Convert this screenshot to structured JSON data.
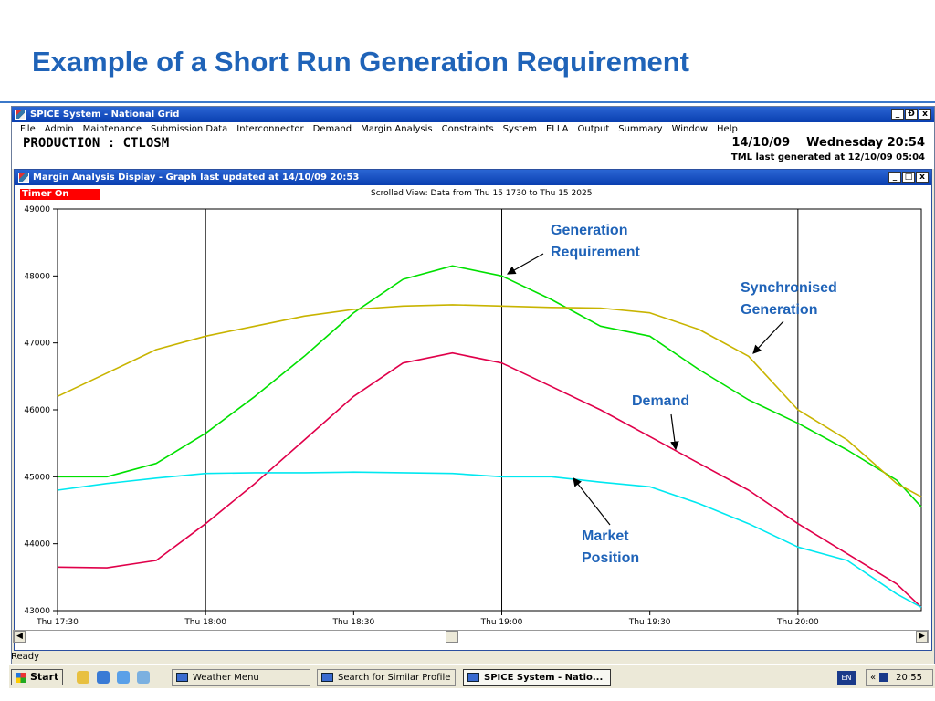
{
  "slide": {
    "title": "Example of a Short Run Generation Requirement"
  },
  "app": {
    "title": "SPICE System - National Grid",
    "window_buttons": [
      "_",
      "Ɖ",
      "x"
    ],
    "menu": [
      "File",
      "Admin",
      "Maintenance",
      "Submission Data",
      "Interconnector",
      "Demand",
      "Margin Analysis",
      "Constraints",
      "System",
      "ELLA",
      "Output",
      "Summary",
      "Window",
      "Help"
    ],
    "production": "PRODUCTION : CTLOSM",
    "date": "14/10/09",
    "day_time": "Wednesday 20:54",
    "tml": "TML last generated at 12/10/09 05:04"
  },
  "child": {
    "title": "Margin Analysis Display - Graph last updated at 14/10/09 20:53",
    "timer": "Timer On",
    "scrolled_view": "Scrolled View: Data from Thu 15 1730  to Thu 15 2025"
  },
  "annotations": {
    "generation_requirement": [
      "Generation",
      "Requirement"
    ],
    "synchronised_generation": [
      "Synchronised",
      "Generation"
    ],
    "demand": "Demand",
    "market_position": [
      "Market",
      "Position"
    ]
  },
  "chart_data": {
    "type": "line",
    "x": [
      "17:30",
      "17:40",
      "17:50",
      "18:00",
      "18:10",
      "18:20",
      "18:30",
      "18:40",
      "18:50",
      "19:00",
      "19:10",
      "19:20",
      "19:30",
      "19:40",
      "19:50",
      "20:00",
      "20:10",
      "20:20",
      "20:25"
    ],
    "x_tick_labels": [
      "Thu 17:30",
      "Thu 18:00",
      "Thu 18:30",
      "Thu 19:00",
      "Thu 19:30",
      "Thu 20:00"
    ],
    "y_tick_labels": [
      "49000",
      "48000",
      "47000",
      "46000",
      "45000",
      "44000",
      "43000"
    ],
    "ylim": [
      43000,
      49000
    ],
    "vertical_markers": [
      "18:00",
      "19:00",
      "20:00"
    ],
    "grid": false,
    "series": [
      {
        "color": "#00e000",
        "values": [
          45000,
          45000,
          45200,
          45650,
          46200,
          46800,
          47450,
          47950,
          48150,
          48000,
          47650,
          47250,
          47100,
          46600,
          46150,
          45800,
          45400,
          44950,
          44550
        ]
      },
      {
        "color": "#c8b400",
        "values": [
          46200,
          46550,
          46900,
          47100,
          47250,
          47400,
          47500,
          47550,
          47570,
          47550,
          47530,
          47520,
          47450,
          47200,
          46800,
          46000,
          45550,
          44900,
          44700
        ]
      },
      {
        "color": "#e0004a",
        "values": [
          43650,
          43640,
          43750,
          44300,
          44900,
          45550,
          46200,
          46700,
          46850,
          46700,
          46350,
          46000,
          45600,
          45200,
          44800,
          44300,
          43850,
          43400,
          43050
        ]
      },
      {
        "color": "#00e8f0",
        "values": [
          44800,
          44900,
          44980,
          45050,
          45060,
          45060,
          45070,
          45060,
          45050,
          45000,
          45000,
          44920,
          44850,
          44600,
          44300,
          43950,
          43750,
          43250,
          43050
        ]
      }
    ]
  }
}
